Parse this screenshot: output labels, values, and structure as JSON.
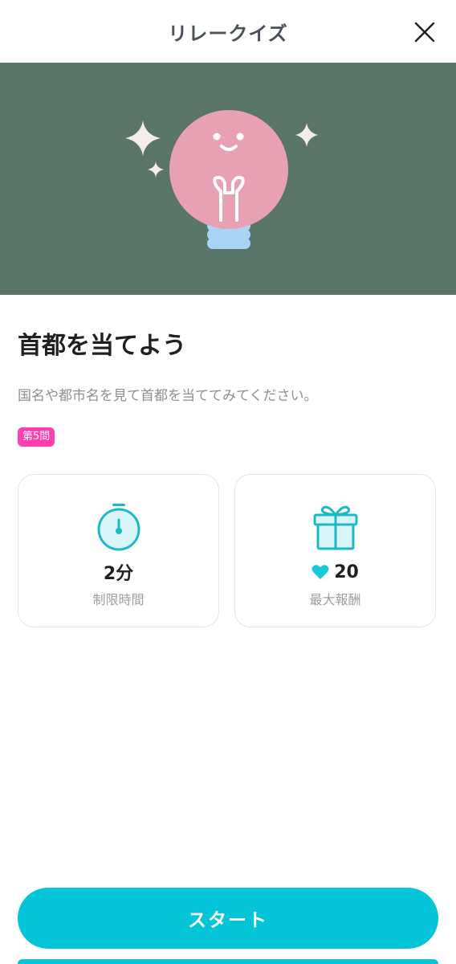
{
  "header": {
    "title": "リレークイズ"
  },
  "quiz": {
    "title": "首都を当てよう",
    "description": "国名や都市名を見て首都を当ててみてください。",
    "badge": "第5問"
  },
  "cards": {
    "time": {
      "value": "2分",
      "label": "制限時間",
      "icon": "stopwatch-icon"
    },
    "reward": {
      "value": "20",
      "label": "最大報酬",
      "icon": "gift-icon",
      "value_icon": "heart-icon"
    }
  },
  "actions": {
    "start_label": "スタート"
  },
  "colors": {
    "hero_bg": "#5a7669",
    "accent": "#04c5d7",
    "badge": "#ff3fae",
    "bulb": "#e8a1b3",
    "bulb_base": "#a9d4f5"
  }
}
